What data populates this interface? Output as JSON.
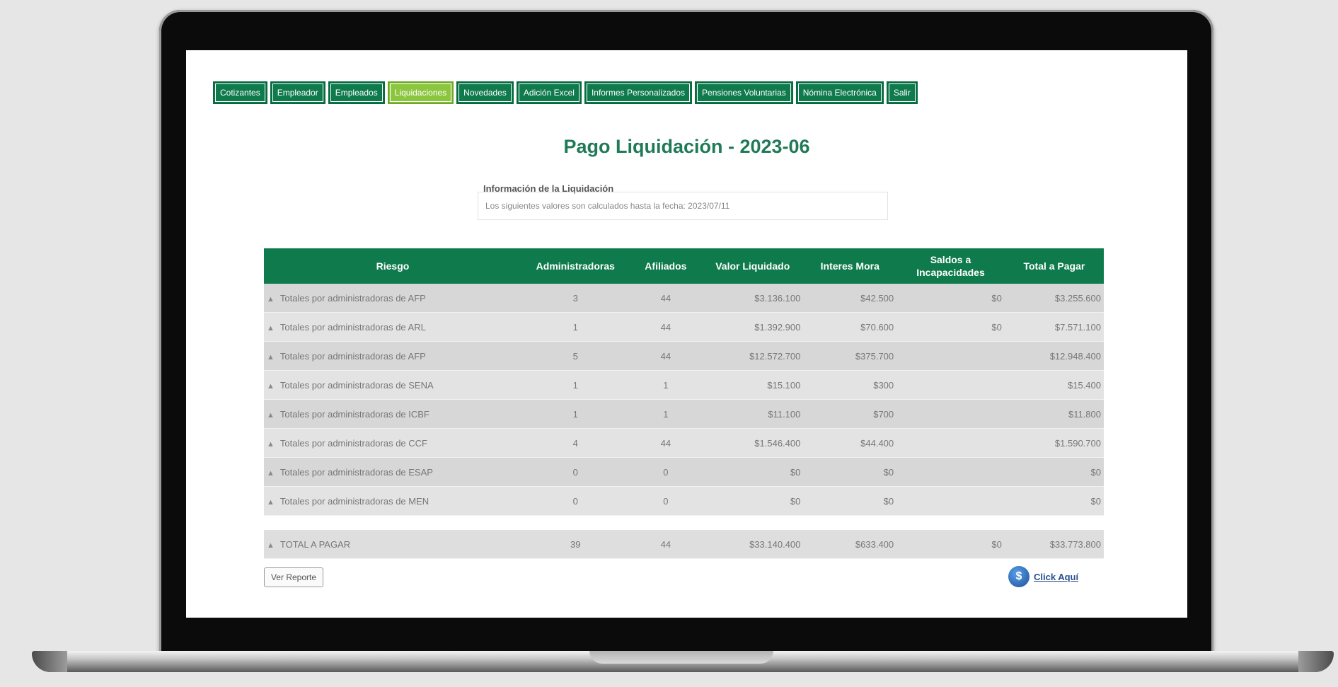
{
  "nav": {
    "tabs": [
      {
        "label": "Cotizantes"
      },
      {
        "label": "Empleador"
      },
      {
        "label": "Empleados"
      },
      {
        "label": "Liquidaciones",
        "active": true
      },
      {
        "label": "Novedades"
      },
      {
        "label": "Adición Excel"
      },
      {
        "label": "Informes Personalizados"
      },
      {
        "label": "Pensiones Voluntarias"
      },
      {
        "label": "Nómina Electrónica"
      },
      {
        "label": "Salir"
      }
    ]
  },
  "page": {
    "title": "Pago Liquidación - 2023-06",
    "info_label": "Información de la Liquidación",
    "info_text": "Los siguientes valores son calculados hasta la fecha: 2023/07/11"
  },
  "table": {
    "headers": [
      "Riesgo",
      "Administradoras",
      "Afiliados",
      "Valor Liquidado",
      "Interes Mora",
      "Saldos a Incapacidades",
      "Total a Pagar"
    ],
    "rows": [
      {
        "riesgo": "Totales por administradoras de AFP",
        "administradoras": "3",
        "afiliados": "44",
        "valor": "$3.136.100",
        "mora": "$42.500",
        "saldos": "$0",
        "total": "$3.255.600"
      },
      {
        "riesgo": "Totales por administradoras de ARL",
        "administradoras": "1",
        "afiliados": "44",
        "valor": "$1.392.900",
        "mora": "$70.600",
        "saldos": "$0",
        "total": "$7.571.100"
      },
      {
        "riesgo": "Totales por administradoras de AFP",
        "administradoras": "5",
        "afiliados": "44",
        "valor": "$12.572.700",
        "mora": "$375.700",
        "saldos": "",
        "total": "$12.948.400"
      },
      {
        "riesgo": "Totales por administradoras de SENA",
        "administradoras": "1",
        "afiliados": "1",
        "valor": "$15.100",
        "mora": "$300",
        "saldos": "",
        "total": "$15.400"
      },
      {
        "riesgo": "Totales por administradoras de ICBF",
        "administradoras": "1",
        "afiliados": "1",
        "valor": "$11.100",
        "mora": "$700",
        "saldos": "",
        "total": "$11.800"
      },
      {
        "riesgo": "Totales por administradoras de CCF",
        "administradoras": "4",
        "afiliados": "44",
        "valor": "$1.546.400",
        "mora": "$44.400",
        "saldos": "",
        "total": "$1.590.700"
      },
      {
        "riesgo": "Totales por administradoras de ESAP",
        "administradoras": "0",
        "afiliados": "0",
        "valor": "$0",
        "mora": "$0",
        "saldos": "",
        "total": "$0"
      },
      {
        "riesgo": "Totales por administradoras de MEN",
        "administradoras": "0",
        "afiliados": "0",
        "valor": "$0",
        "mora": "$0",
        "saldos": "",
        "total": "$0"
      }
    ],
    "total": {
      "riesgo": "TOTAL A PAGAR",
      "administradoras": "39",
      "afiliados": "44",
      "valor": "$33.140.400",
      "mora": "$633.400",
      "saldos": "$0",
      "total": "$33.773.800"
    },
    "expand_glyph": "▲"
  },
  "buttons": {
    "report": "Ver Reporte",
    "click_here": "Click Aquí",
    "click_icon_glyph": "$"
  }
}
